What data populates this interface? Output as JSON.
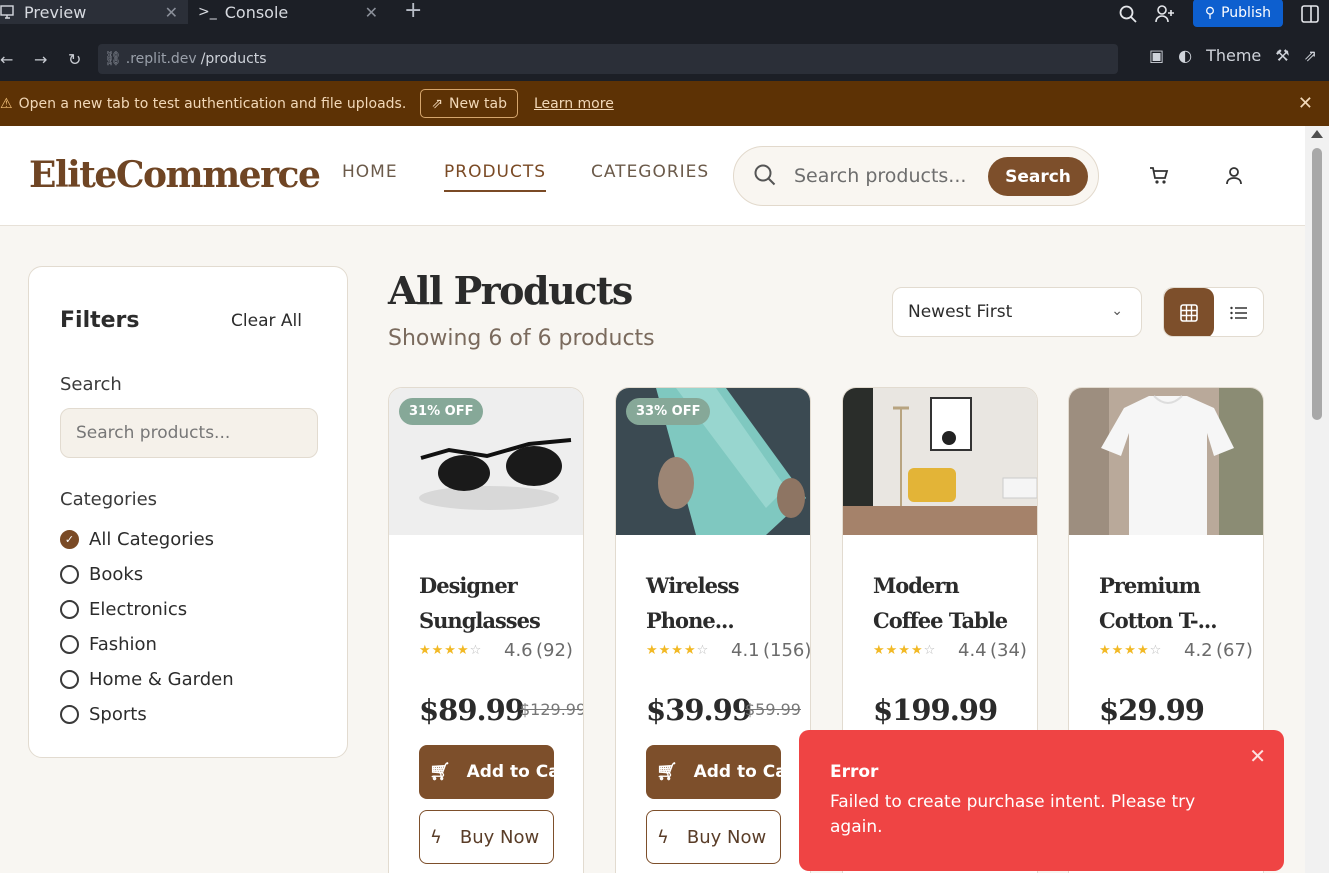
{
  "ide": {
    "tabs": [
      {
        "label": "Preview"
      },
      {
        "label": "Console"
      }
    ],
    "publish_label": "Publish",
    "theme_label": "Theme",
    "url": {
      "host": ".replit.dev",
      "path": "/products"
    }
  },
  "banner": {
    "message": "Open a new tab to test authentication and file uploads.",
    "new_tab_label": "New tab",
    "learn_more_label": "Learn more"
  },
  "store": {
    "logo": "EliteCommerce",
    "nav": [
      {
        "label": "HOME"
      },
      {
        "label": "PRODUCTS"
      },
      {
        "label": "CATEGORIES"
      }
    ],
    "search": {
      "placeholder": "Search products...",
      "button": "Search"
    }
  },
  "filters": {
    "title": "Filters",
    "clear_label": "Clear All",
    "search_label": "Search",
    "search_placeholder": "Search products...",
    "categories_label": "Categories",
    "categories": [
      {
        "label": "All Categories",
        "selected": true
      },
      {
        "label": "Books",
        "selected": false
      },
      {
        "label": "Electronics",
        "selected": false
      },
      {
        "label": "Fashion",
        "selected": false
      },
      {
        "label": "Home & Garden",
        "selected": false
      },
      {
        "label": "Sports",
        "selected": false
      }
    ]
  },
  "products_header": {
    "title": "All Products",
    "count_text": "Showing 6 of 6 products",
    "sort_value": "Newest First"
  },
  "products": [
    {
      "name": "Designer\nSunglasses",
      "badge": "31% OFF",
      "rating": "4.6",
      "reviews": "(92)",
      "price": "$89.99",
      "old_price": "$129.99"
    },
    {
      "name": "Wireless\nPhone...",
      "badge": "33% OFF",
      "rating": "4.1",
      "reviews": "(156)",
      "price": "$39.99",
      "old_price": "$59.99"
    },
    {
      "name": "Modern\nCoffee Table",
      "badge": "",
      "rating": "4.4",
      "reviews": "(34)",
      "price": "$199.99",
      "old_price": ""
    },
    {
      "name": "Premium\nCotton T-...",
      "badge": "",
      "rating": "4.2",
      "reviews": "(67)",
      "price": "$29.99",
      "old_price": ""
    }
  ],
  "buttons": {
    "add_to_cart": "Add to Cart",
    "buy_now": "Buy Now"
  },
  "toast": {
    "title": "Error",
    "message": "Failed to create purchase intent. Please try again."
  },
  "colors": {
    "brand": "#7d4f2b",
    "error": "#ef4444",
    "banner": "#5d3205"
  }
}
